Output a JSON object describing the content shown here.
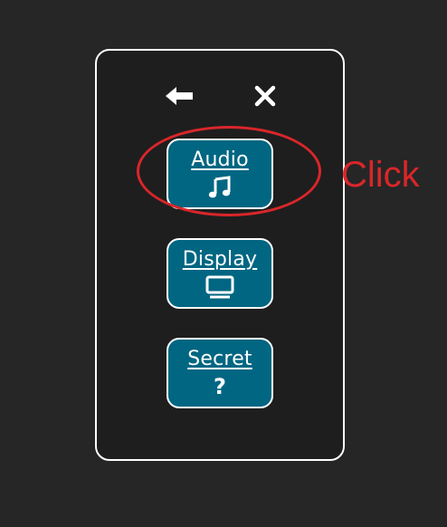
{
  "header": {
    "back_icon": "arrow-left-icon",
    "close_icon": "close-icon"
  },
  "menu": {
    "items": [
      {
        "label": "Audio",
        "icon": "music-note-icon"
      },
      {
        "label": "Display",
        "icon": "monitor-icon"
      },
      {
        "label": "Secret",
        "icon": "question-mark-icon",
        "icon_text": "?"
      }
    ]
  },
  "annotation": {
    "text": "Click",
    "color": "#d9262a"
  },
  "colors": {
    "background": "#262626",
    "panel": "#1e1e1e",
    "button": "#006682",
    "border": "#ffffff"
  }
}
